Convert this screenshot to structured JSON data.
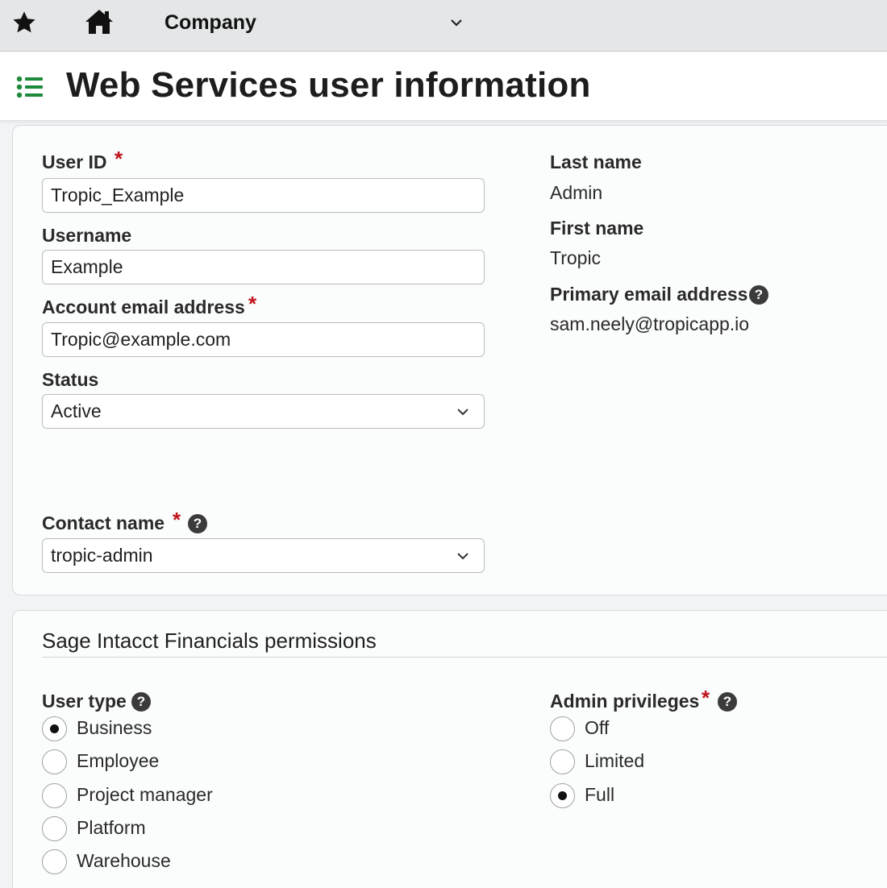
{
  "topbar": {
    "company_label": "Company"
  },
  "header": {
    "title": "Web Services user information"
  },
  "form": {
    "user_id": {
      "label": "User ID",
      "required_mark": "*",
      "value": "Tropic_Example"
    },
    "username": {
      "label": "Username",
      "value": "Example"
    },
    "account_email": {
      "label": "Account email address",
      "required_mark": "*",
      "value": "Tropic@example.com"
    },
    "status": {
      "label": "Status",
      "selected": "Active"
    },
    "contact_name": {
      "label": "Contact name",
      "required_mark": "*",
      "help": "?",
      "selected": "tropic-admin"
    }
  },
  "info": {
    "last_name": {
      "label": "Last name",
      "value": "Admin"
    },
    "first_name": {
      "label": "First name",
      "value": "Tropic"
    },
    "primary_email": {
      "label": "Primary email address",
      "help": "?",
      "value": "sam.neely@tropicapp.io"
    }
  },
  "permissions": {
    "title": "Sage Intacct Financials permissions",
    "user_type": {
      "label": "User type",
      "help": "?",
      "options": [
        "Business",
        "Employee",
        "Project manager",
        "Platform",
        "Warehouse"
      ],
      "selected": "Business"
    },
    "admin_privileges": {
      "label": "Admin privileges",
      "required_mark": "*",
      "help": "?",
      "options": [
        "Off",
        "Limited",
        "Full"
      ],
      "selected": "Full"
    }
  },
  "colors": {
    "required": "#c0141c",
    "list_icon": "#1e8a3b",
    "topbar_bg": "#e4e6e7"
  },
  "icons": {
    "favorite": "star-icon",
    "home": "home-icon",
    "menu": "list-icon",
    "help": "help-icon",
    "dropdown": "chevron-down-icon"
  }
}
